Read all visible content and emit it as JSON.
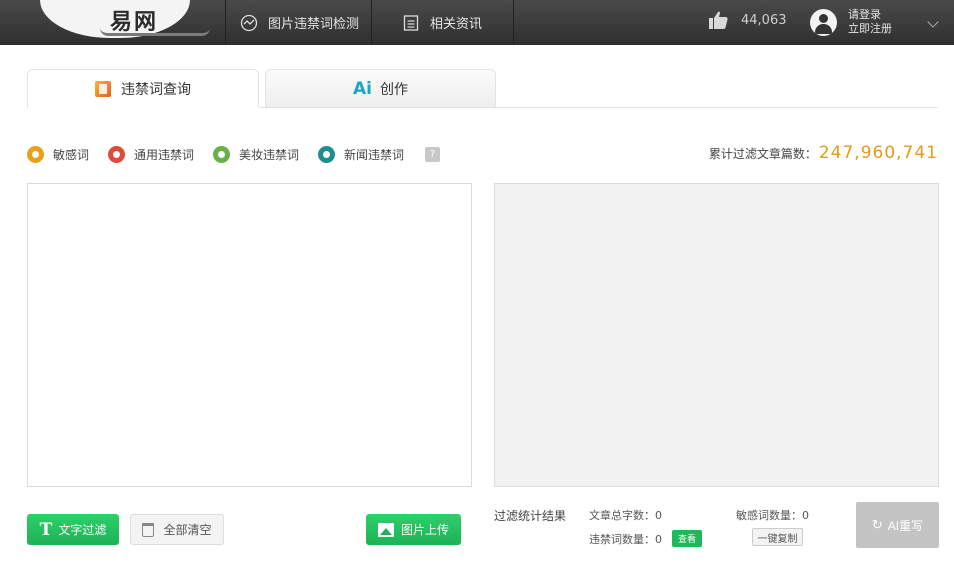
{
  "header": {
    "logo": "易网",
    "nav": [
      {
        "label": "图片违禁词检测",
        "icon": "image-scan-icon"
      },
      {
        "label": "相关资讯",
        "icon": "news-icon"
      }
    ],
    "likes": "44,063",
    "login": "请登录",
    "register": "立即注册"
  },
  "tabs": [
    {
      "label": "违禁词查询",
      "active": true
    },
    {
      "label": "创作",
      "prefix": "Ai",
      "active": false
    }
  ],
  "legend": [
    {
      "label": "敏感词",
      "color": "#e8a21a"
    },
    {
      "label": "通用违禁词",
      "color": "#e04a3a"
    },
    {
      "label": "美妆违禁词",
      "color": "#67b04a"
    },
    {
      "label": "新闻违禁词",
      "color": "#1f8e8e"
    }
  ],
  "help_mark": "?",
  "total": {
    "label": "累计过滤文章篇数：",
    "value": "247,960,741"
  },
  "buttons": {
    "filter_icon": "T",
    "filter": "文字过滤",
    "clear": "全部清空",
    "upload": "图片上传",
    "ai": "AI重写",
    "ai_icon": "↻"
  },
  "results": {
    "title": "过滤统计结果",
    "total_chars": "文章总字数：0",
    "banned_count": "违禁词数量：0",
    "view": "查看",
    "sensitive_count": "敏感词数量：0",
    "copy": "一键复制"
  }
}
